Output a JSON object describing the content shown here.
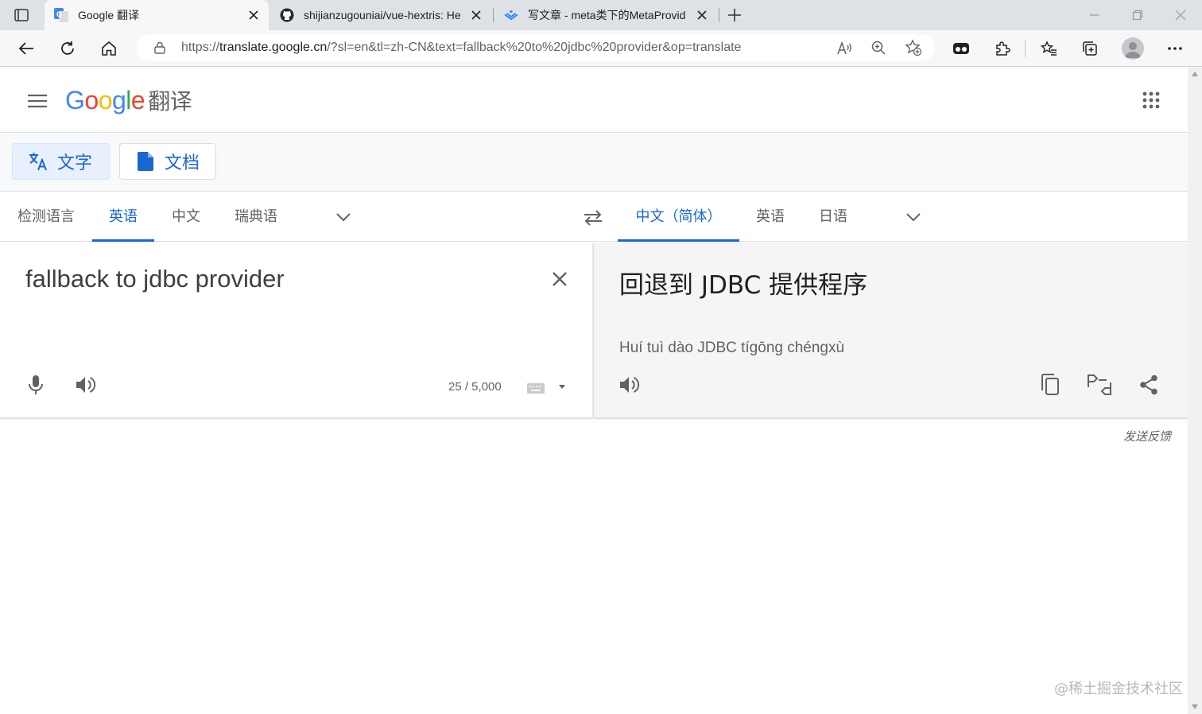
{
  "browser": {
    "tabs": [
      {
        "title": "Google 翻译",
        "active": true
      },
      {
        "title": "shijianzugouniai/vue-hextris: He",
        "active": false
      },
      {
        "title": "写文章 - meta类下的MetaProvid",
        "active": false
      }
    ],
    "url_prefix": "https://",
    "url_host": "translate.google.cn",
    "url_path": "/?sl=en&tl=zh-CN&text=fallback%20to%20jdbc%20provider&op=translate"
  },
  "header": {
    "logo_letters": [
      "G",
      "o",
      "o",
      "g",
      "l",
      "e"
    ],
    "product": "翻译"
  },
  "modes": {
    "text_label": "文字",
    "doc_label": "文档"
  },
  "source_langs": [
    "检测语言",
    "英语",
    "中文",
    "瑞典语"
  ],
  "target_langs": [
    "中文（简体）",
    "英语",
    "日语"
  ],
  "source": {
    "text": "fallback to jdbc provider",
    "char_count": "25 / 5,000"
  },
  "target": {
    "text": "回退到 JDBC 提供程序",
    "transliteration": "Huí tuì dào JDBC tígōng chéngxù"
  },
  "footer": {
    "feedback": "发送反馈",
    "watermark": "@稀土掘金技术社区"
  },
  "colors": {
    "accent": "#1967d2",
    "icon_gray": "#5f6368"
  }
}
